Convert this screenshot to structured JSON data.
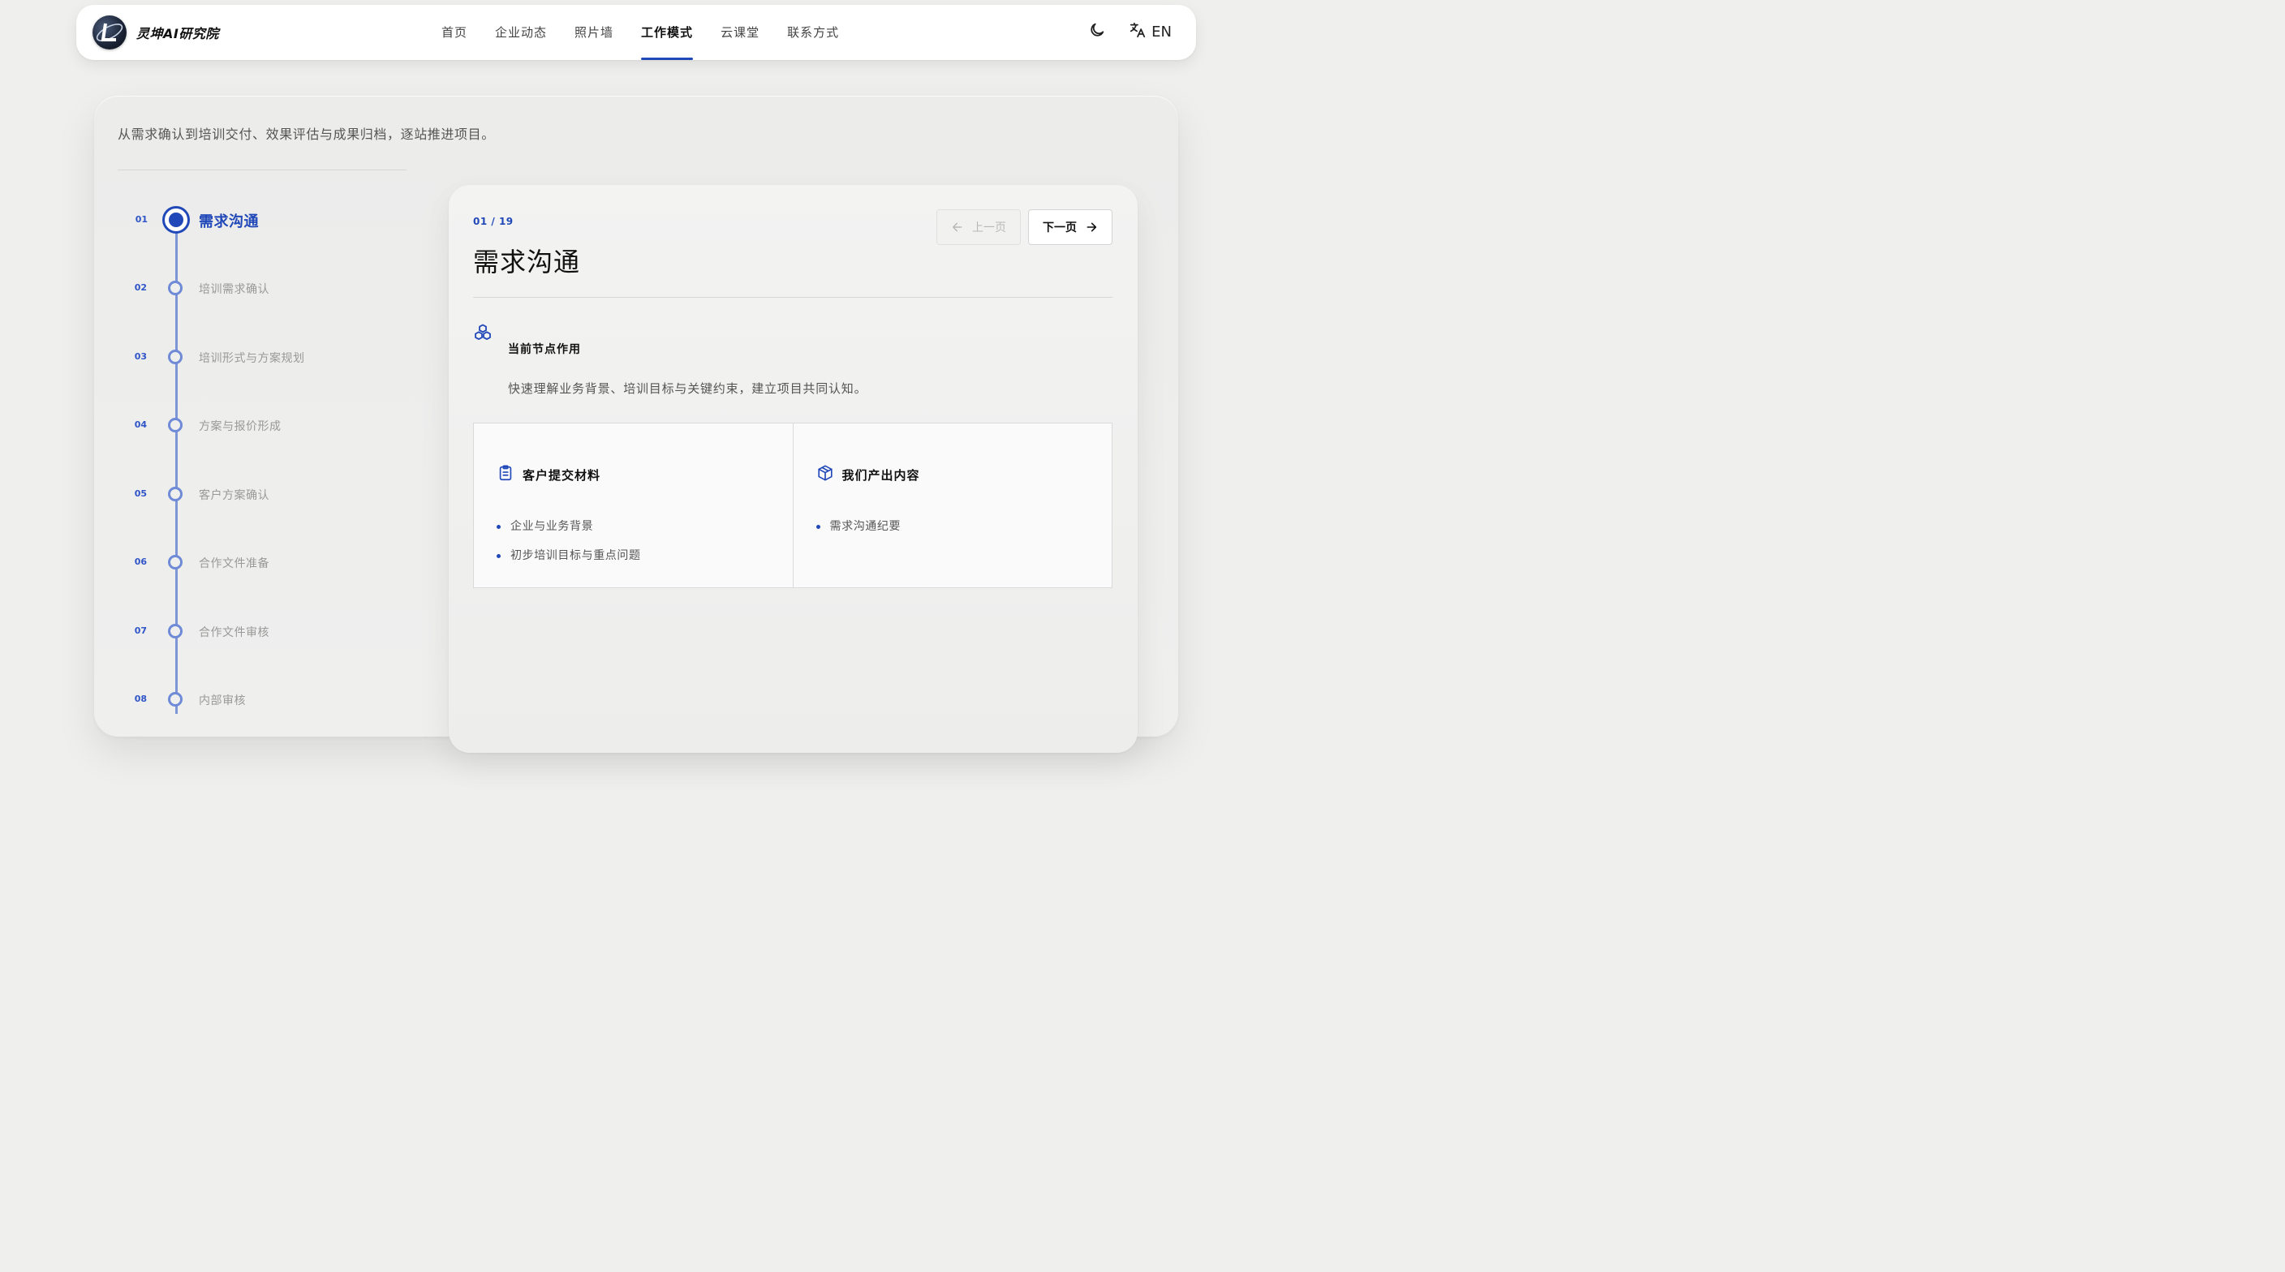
{
  "header": {
    "brand_name": "灵坤AI研究院",
    "nav": [
      {
        "label": "首页",
        "active": false
      },
      {
        "label": "企业动态",
        "active": false
      },
      {
        "label": "照片墙",
        "active": false
      },
      {
        "label": "工作模式",
        "active": true
      },
      {
        "label": "云课堂",
        "active": false
      },
      {
        "label": "联系方式",
        "active": false
      }
    ],
    "theme_icon": "moon-icon",
    "lang_icon": "translate-icon",
    "lang_label": "EN"
  },
  "intro": "从需求确认到培训交付、效果评估与成果归档，逐站推进项目。",
  "steps": [
    {
      "num": "01",
      "label": "需求沟通",
      "active": true
    },
    {
      "num": "02",
      "label": "培训需求确认",
      "active": false
    },
    {
      "num": "03",
      "label": "培训形式与方案规划",
      "active": false
    },
    {
      "num": "04",
      "label": "方案与报价形成",
      "active": false
    },
    {
      "num": "05",
      "label": "客户方案确认",
      "active": false
    },
    {
      "num": "06",
      "label": "合作文件准备",
      "active": false
    },
    {
      "num": "07",
      "label": "合作文件审核",
      "active": false
    },
    {
      "num": "08",
      "label": "内部审核",
      "active": false
    }
  ],
  "detail": {
    "counter": "01 / 19",
    "title": "需求沟通",
    "prev_label": "上一页",
    "next_label": "下一页",
    "role_heading": "当前节点作用",
    "role_desc": "快速理解业务背景、培训目标与关键约束，建立项目共同认知。",
    "client_box": {
      "title": "客户提交材料",
      "icon": "clipboard-icon",
      "items": [
        "企业与业务背景",
        "初步培训目标与重点问题"
      ]
    },
    "our_box": {
      "title": "我们产出内容",
      "icon": "package-icon",
      "items": [
        "需求沟通纪要"
      ]
    }
  },
  "colors": {
    "accent": "#2148b8",
    "timeline": "#7d95d6",
    "background": "#efefee"
  }
}
